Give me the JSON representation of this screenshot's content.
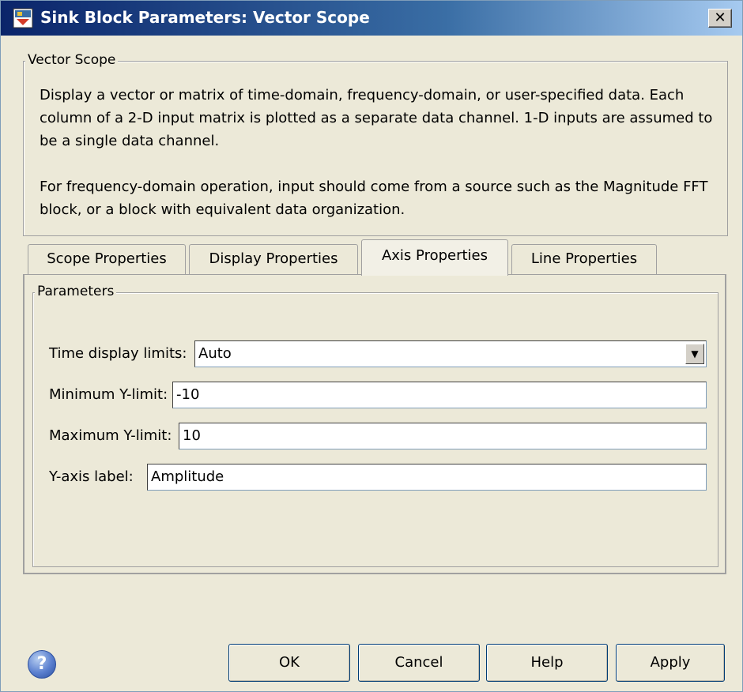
{
  "window": {
    "title": "Sink Block Parameters: Vector Scope",
    "close_glyph": "✕"
  },
  "description": {
    "legend": "Vector Scope",
    "paragraph1": "Display a vector or matrix of time-domain, frequency-domain, or user-specified data. Each column of a 2-D input matrix is plotted as a separate data channel.  1-D inputs are assumed to be a single data channel.",
    "paragraph2": "For frequency-domain operation, input should come from a source such as the Magnitude FFT block, or a block with equivalent data organization."
  },
  "tabs": [
    {
      "label": "Scope Properties",
      "active": false
    },
    {
      "label": "Display Properties",
      "active": false
    },
    {
      "label": "Axis Properties",
      "active": true
    },
    {
      "label": "Line Properties",
      "active": false
    }
  ],
  "parameters": {
    "legend": "Parameters",
    "time_display_limits": {
      "label": "Time display limits:",
      "value": "Auto"
    },
    "min_y_limit": {
      "label": "Minimum Y-limit:",
      "value": "-10"
    },
    "max_y_limit": {
      "label": "Maximum Y-limit:",
      "value": "10"
    },
    "y_axis_label": {
      "label": "Y-axis label:",
      "value": "Amplitude"
    }
  },
  "buttons": {
    "ok": "OK",
    "cancel": "Cancel",
    "help": "Help",
    "apply": "Apply",
    "help_icon_glyph": "?"
  },
  "colors": {
    "titlebar_start": "#0a246a",
    "titlebar_end": "#a6caf0",
    "dialog_bg": "#ece9d8"
  }
}
